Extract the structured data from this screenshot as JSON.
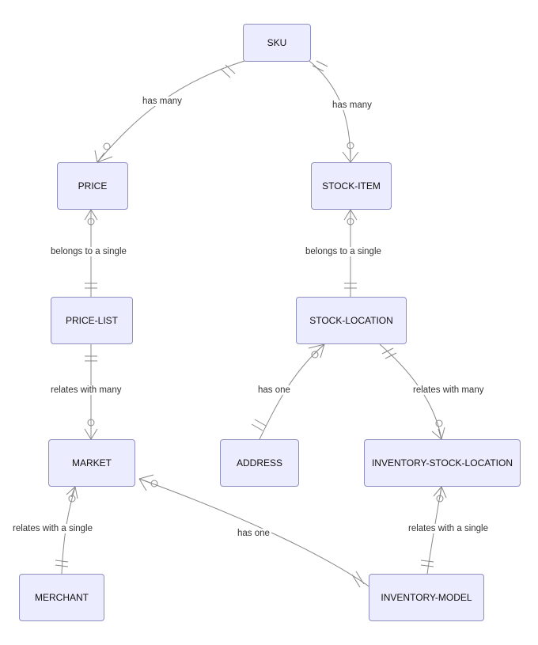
{
  "entities": {
    "sku": "SKU",
    "price": "PRICE",
    "stock_item": "STOCK-ITEM",
    "price_list": "PRICE-LIST",
    "stock_location": "STOCK-LOCATION",
    "address": "ADDRESS",
    "inventory_stock_location": "INVENTORY-STOCK-LOCATION",
    "market": "MARKET",
    "merchant": "MERCHANT",
    "inventory_model": "INVENTORY-MODEL"
  },
  "relations": {
    "sku_price": "has many",
    "sku_stock_item": "has many",
    "price_price_list": "belongs to a single",
    "stock_item_stock_location": "belongs to a single",
    "price_list_market": "relates with many",
    "stock_location_address": "has one",
    "stock_location_isl": "relates with many",
    "market_merchant": "relates with a single",
    "market_inventory_model": "has one",
    "isl_inventory_model": "relates with a single"
  }
}
